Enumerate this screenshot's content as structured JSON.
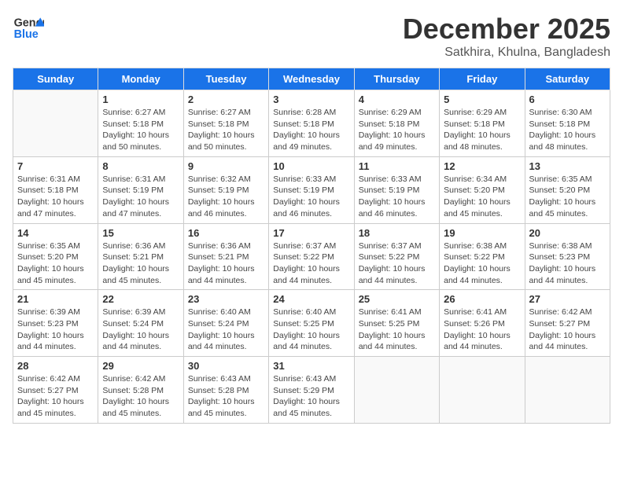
{
  "header": {
    "logo_general": "General",
    "logo_blue": "Blue",
    "title": "December 2025",
    "subtitle": "Satkhira, Khulna, Bangladesh"
  },
  "weekdays": [
    "Sunday",
    "Monday",
    "Tuesday",
    "Wednesday",
    "Thursday",
    "Friday",
    "Saturday"
  ],
  "weeks": [
    [
      {
        "day": "",
        "detail": ""
      },
      {
        "day": "1",
        "detail": "Sunrise: 6:27 AM\nSunset: 5:18 PM\nDaylight: 10 hours\nand 50 minutes."
      },
      {
        "day": "2",
        "detail": "Sunrise: 6:27 AM\nSunset: 5:18 PM\nDaylight: 10 hours\nand 50 minutes."
      },
      {
        "day": "3",
        "detail": "Sunrise: 6:28 AM\nSunset: 5:18 PM\nDaylight: 10 hours\nand 49 minutes."
      },
      {
        "day": "4",
        "detail": "Sunrise: 6:29 AM\nSunset: 5:18 PM\nDaylight: 10 hours\nand 49 minutes."
      },
      {
        "day": "5",
        "detail": "Sunrise: 6:29 AM\nSunset: 5:18 PM\nDaylight: 10 hours\nand 48 minutes."
      },
      {
        "day": "6",
        "detail": "Sunrise: 6:30 AM\nSunset: 5:18 PM\nDaylight: 10 hours\nand 48 minutes."
      }
    ],
    [
      {
        "day": "7",
        "detail": "Sunrise: 6:31 AM\nSunset: 5:18 PM\nDaylight: 10 hours\nand 47 minutes."
      },
      {
        "day": "8",
        "detail": "Sunrise: 6:31 AM\nSunset: 5:19 PM\nDaylight: 10 hours\nand 47 minutes."
      },
      {
        "day": "9",
        "detail": "Sunrise: 6:32 AM\nSunset: 5:19 PM\nDaylight: 10 hours\nand 46 minutes."
      },
      {
        "day": "10",
        "detail": "Sunrise: 6:33 AM\nSunset: 5:19 PM\nDaylight: 10 hours\nand 46 minutes."
      },
      {
        "day": "11",
        "detail": "Sunrise: 6:33 AM\nSunset: 5:19 PM\nDaylight: 10 hours\nand 46 minutes."
      },
      {
        "day": "12",
        "detail": "Sunrise: 6:34 AM\nSunset: 5:20 PM\nDaylight: 10 hours\nand 45 minutes."
      },
      {
        "day": "13",
        "detail": "Sunrise: 6:35 AM\nSunset: 5:20 PM\nDaylight: 10 hours\nand 45 minutes."
      }
    ],
    [
      {
        "day": "14",
        "detail": "Sunrise: 6:35 AM\nSunset: 5:20 PM\nDaylight: 10 hours\nand 45 minutes."
      },
      {
        "day": "15",
        "detail": "Sunrise: 6:36 AM\nSunset: 5:21 PM\nDaylight: 10 hours\nand 45 minutes."
      },
      {
        "day": "16",
        "detail": "Sunrise: 6:36 AM\nSunset: 5:21 PM\nDaylight: 10 hours\nand 44 minutes."
      },
      {
        "day": "17",
        "detail": "Sunrise: 6:37 AM\nSunset: 5:22 PM\nDaylight: 10 hours\nand 44 minutes."
      },
      {
        "day": "18",
        "detail": "Sunrise: 6:37 AM\nSunset: 5:22 PM\nDaylight: 10 hours\nand 44 minutes."
      },
      {
        "day": "19",
        "detail": "Sunrise: 6:38 AM\nSunset: 5:22 PM\nDaylight: 10 hours\nand 44 minutes."
      },
      {
        "day": "20",
        "detail": "Sunrise: 6:38 AM\nSunset: 5:23 PM\nDaylight: 10 hours\nand 44 minutes."
      }
    ],
    [
      {
        "day": "21",
        "detail": "Sunrise: 6:39 AM\nSunset: 5:23 PM\nDaylight: 10 hours\nand 44 minutes."
      },
      {
        "day": "22",
        "detail": "Sunrise: 6:39 AM\nSunset: 5:24 PM\nDaylight: 10 hours\nand 44 minutes."
      },
      {
        "day": "23",
        "detail": "Sunrise: 6:40 AM\nSunset: 5:24 PM\nDaylight: 10 hours\nand 44 minutes."
      },
      {
        "day": "24",
        "detail": "Sunrise: 6:40 AM\nSunset: 5:25 PM\nDaylight: 10 hours\nand 44 minutes."
      },
      {
        "day": "25",
        "detail": "Sunrise: 6:41 AM\nSunset: 5:25 PM\nDaylight: 10 hours\nand 44 minutes."
      },
      {
        "day": "26",
        "detail": "Sunrise: 6:41 AM\nSunset: 5:26 PM\nDaylight: 10 hours\nand 44 minutes."
      },
      {
        "day": "27",
        "detail": "Sunrise: 6:42 AM\nSunset: 5:27 PM\nDaylight: 10 hours\nand 44 minutes."
      }
    ],
    [
      {
        "day": "28",
        "detail": "Sunrise: 6:42 AM\nSunset: 5:27 PM\nDaylight: 10 hours\nand 45 minutes."
      },
      {
        "day": "29",
        "detail": "Sunrise: 6:42 AM\nSunset: 5:28 PM\nDaylight: 10 hours\nand 45 minutes."
      },
      {
        "day": "30",
        "detail": "Sunrise: 6:43 AM\nSunset: 5:28 PM\nDaylight: 10 hours\nand 45 minutes."
      },
      {
        "day": "31",
        "detail": "Sunrise: 6:43 AM\nSunset: 5:29 PM\nDaylight: 10 hours\nand 45 minutes."
      },
      {
        "day": "",
        "detail": ""
      },
      {
        "day": "",
        "detail": ""
      },
      {
        "day": "",
        "detail": ""
      }
    ]
  ]
}
